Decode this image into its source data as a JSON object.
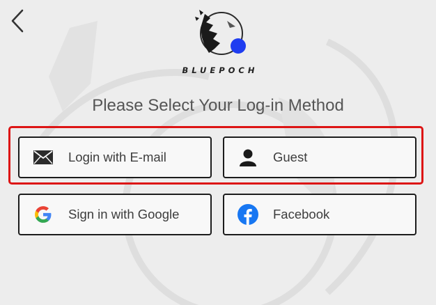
{
  "brand": {
    "logo_text": "BLUEPOCH"
  },
  "header": {
    "title": "Please Select Your Log-in Method"
  },
  "login_options": [
    {
      "label": "Login with E-mail",
      "icon": "envelope-icon"
    },
    {
      "label": "Guest",
      "icon": "person-icon"
    },
    {
      "label": "Sign in with Google",
      "icon": "google-icon"
    },
    {
      "label": "Facebook",
      "icon": "facebook-icon"
    }
  ],
  "colors": {
    "highlight": "#dd1515",
    "facebook": "#1877f2",
    "brand_accent": "#1f3df0",
    "google_blue": "#4285f4",
    "google_red": "#ea4335",
    "google_yellow": "#fbbc05",
    "google_green": "#34a853"
  }
}
